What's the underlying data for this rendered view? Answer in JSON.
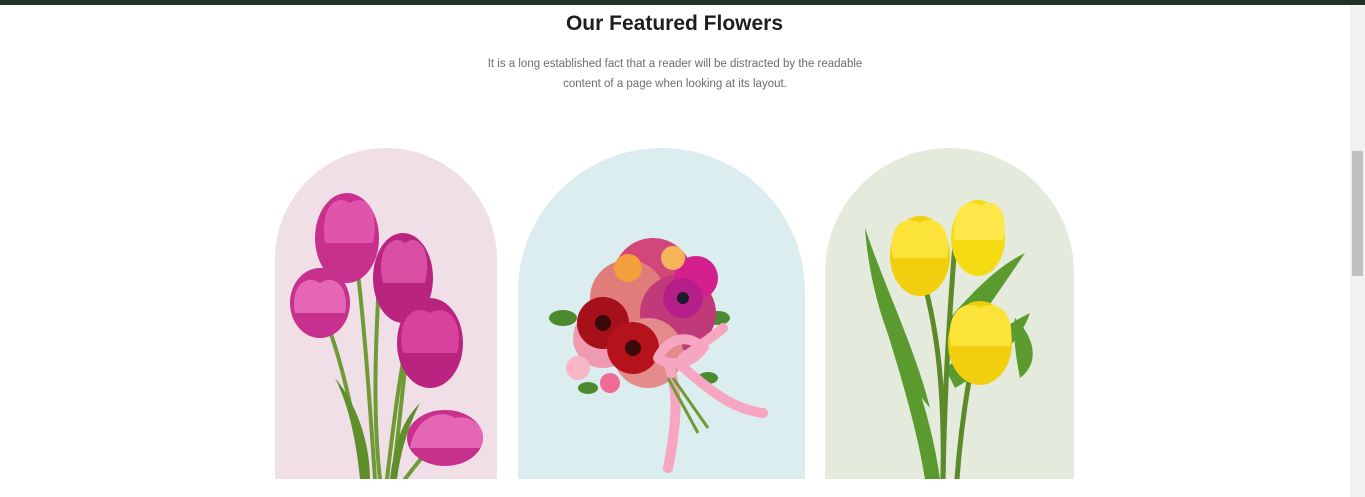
{
  "section": {
    "title": "Our Featured Flowers",
    "description": "It is a long established fact that a reader will be distracted by the readable content of a page when looking at its layout."
  },
  "cards": [
    {
      "image": "pink-tulips-image",
      "background": "#f0dfe7"
    },
    {
      "image": "mixed-bouquet-image",
      "background": "#dcedef"
    },
    {
      "image": "yellow-tulips-image",
      "background": "#e4ebdc"
    }
  ],
  "colors": {
    "topbar": "#223127",
    "pink": "#c8308e",
    "red": "#b5121b",
    "yellow": "#f5dc12",
    "stem": "#5a8a2a"
  }
}
